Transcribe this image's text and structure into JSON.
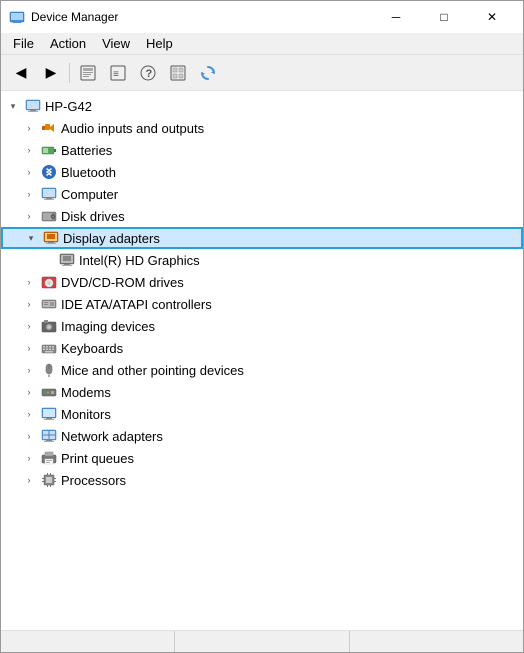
{
  "window": {
    "title": "Device Manager",
    "min_label": "─",
    "max_label": "□",
    "close_label": "✕"
  },
  "menu": {
    "items": [
      "File",
      "Action",
      "View",
      "Help"
    ]
  },
  "toolbar": {
    "buttons": [
      "◀",
      "▶",
      "⊞",
      "⊟",
      "?",
      "⊡",
      "🔄"
    ]
  },
  "tree": {
    "root": {
      "label": "HP-G42",
      "expanded": true
    },
    "items": [
      {
        "id": "audio",
        "label": "Audio inputs and outputs",
        "indent": 1,
        "expandable": true,
        "expanded": false,
        "icon": "🔊"
      },
      {
        "id": "batteries",
        "label": "Batteries",
        "indent": 1,
        "expandable": true,
        "expanded": false,
        "icon": "🔋"
      },
      {
        "id": "bluetooth",
        "label": "Bluetooth",
        "indent": 1,
        "expandable": true,
        "expanded": false,
        "icon": "🔵"
      },
      {
        "id": "computer",
        "label": "Computer",
        "indent": 1,
        "expandable": true,
        "expanded": false,
        "icon": "💻"
      },
      {
        "id": "disk",
        "label": "Disk drives",
        "indent": 1,
        "expandable": true,
        "expanded": false,
        "icon": "💾"
      },
      {
        "id": "display",
        "label": "Display adapters",
        "indent": 1,
        "expandable": true,
        "expanded": true,
        "selected": true,
        "icon": "🖥"
      },
      {
        "id": "intel",
        "label": "Intel(R) HD Graphics",
        "indent": 2,
        "expandable": false,
        "expanded": false,
        "icon": "🖥"
      },
      {
        "id": "dvd",
        "label": "DVD/CD-ROM drives",
        "indent": 1,
        "expandable": true,
        "expanded": false,
        "icon": "💿"
      },
      {
        "id": "ide",
        "label": "IDE ATA/ATAPI controllers",
        "indent": 1,
        "expandable": true,
        "expanded": false,
        "icon": "🔌"
      },
      {
        "id": "imaging",
        "label": "Imaging devices",
        "indent": 1,
        "expandable": true,
        "expanded": false,
        "icon": "📷"
      },
      {
        "id": "keyboards",
        "label": "Keyboards",
        "indent": 1,
        "expandable": true,
        "expanded": false,
        "icon": "⌨"
      },
      {
        "id": "mice",
        "label": "Mice and other pointing devices",
        "indent": 1,
        "expandable": true,
        "expanded": false,
        "icon": "🖱"
      },
      {
        "id": "modems",
        "label": "Modems",
        "indent": 1,
        "expandable": true,
        "expanded": false,
        "icon": "📠"
      },
      {
        "id": "monitors",
        "label": "Monitors",
        "indent": 1,
        "expandable": true,
        "expanded": false,
        "icon": "🖥"
      },
      {
        "id": "network",
        "label": "Network adapters",
        "indent": 1,
        "expandable": true,
        "expanded": false,
        "icon": "🌐"
      },
      {
        "id": "print",
        "label": "Print queues",
        "indent": 1,
        "expandable": true,
        "expanded": false,
        "icon": "🖨"
      },
      {
        "id": "processors",
        "label": "Processors",
        "indent": 1,
        "expandable": true,
        "expanded": false,
        "icon": "⚙"
      }
    ]
  },
  "statusbar": {
    "sections": [
      "",
      "",
      ""
    ]
  },
  "colors": {
    "selected_bg": "#cde8ff",
    "selected_border": "#26a0da",
    "accent": "#0078d7"
  }
}
